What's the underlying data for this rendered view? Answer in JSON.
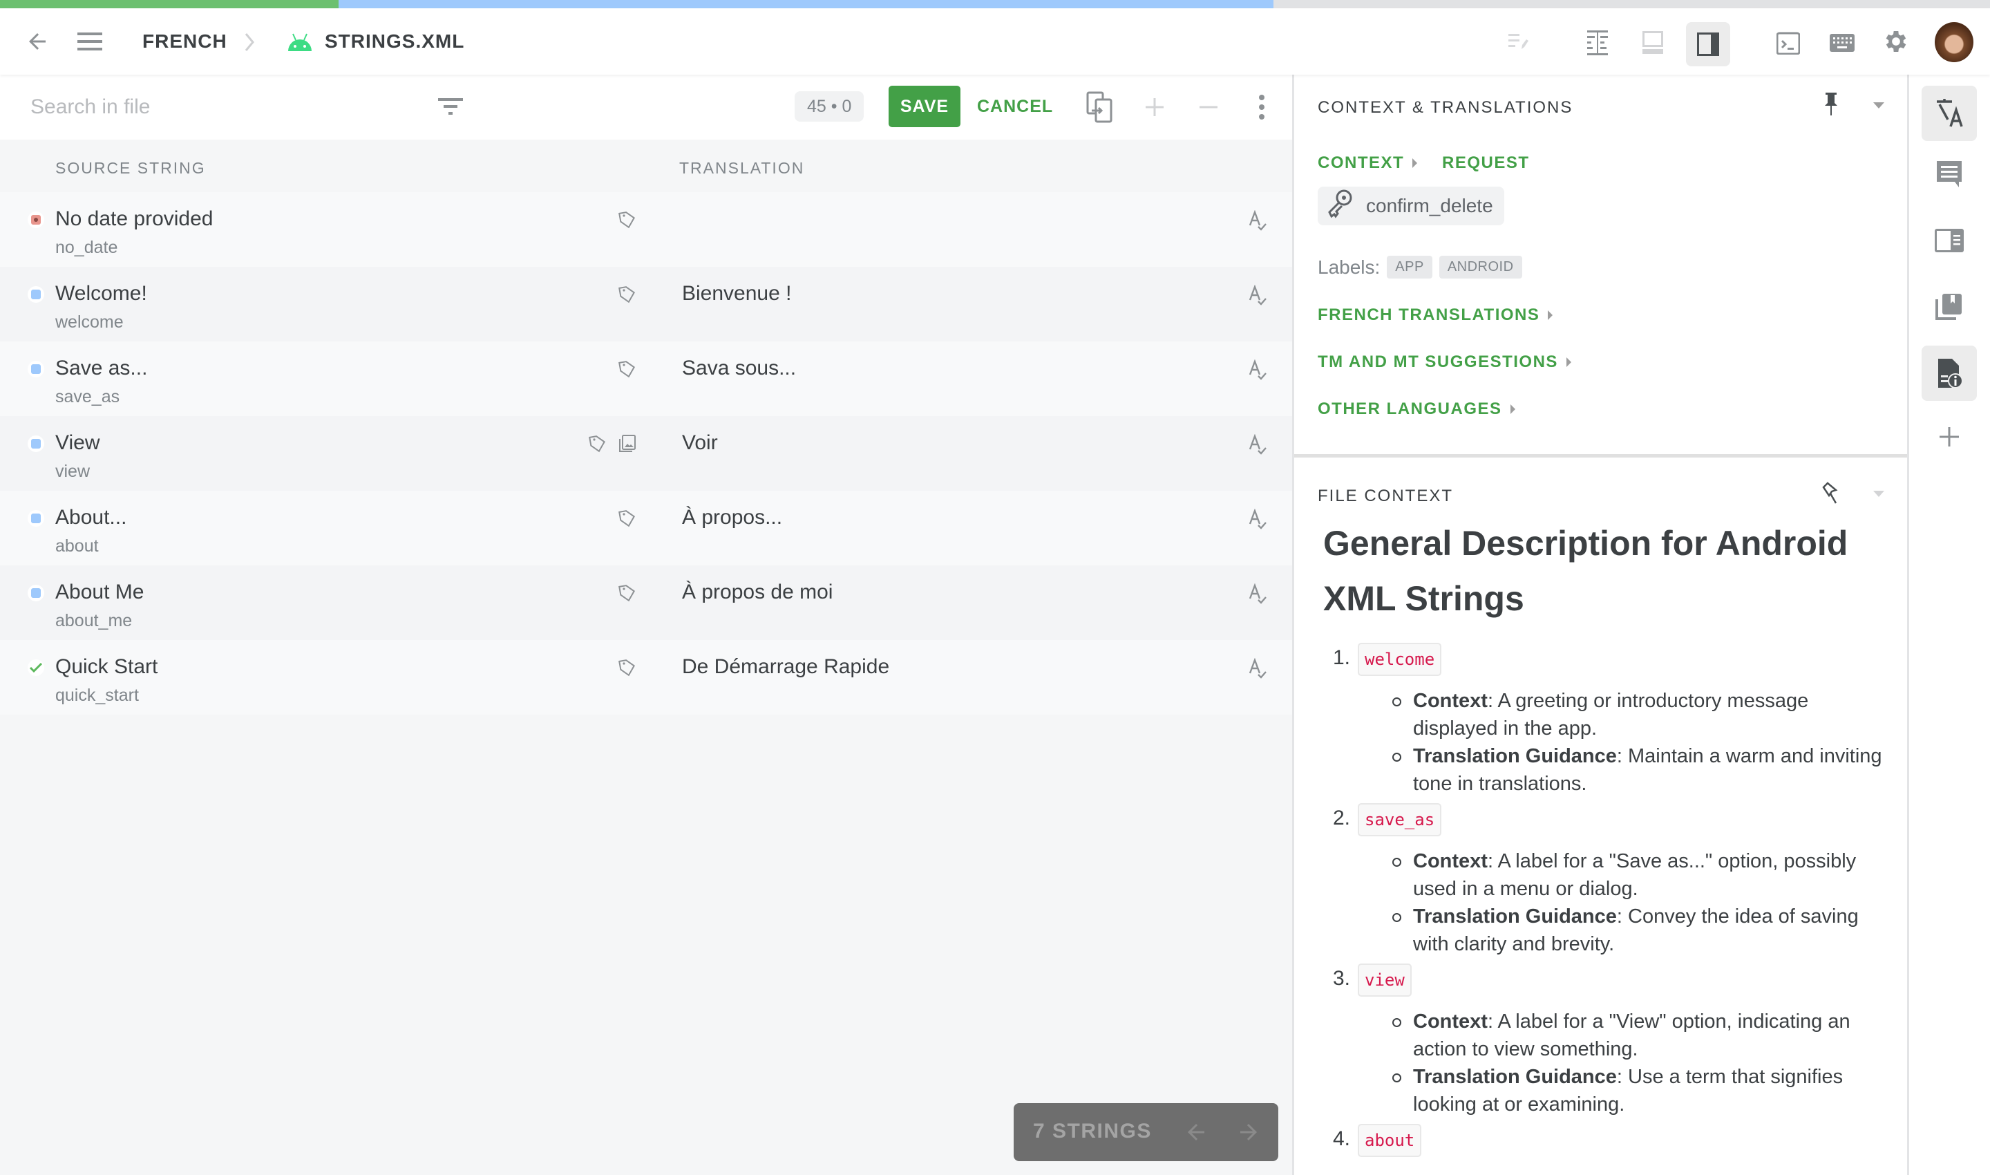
{
  "progress": {
    "approved_fraction": 0.17,
    "translated_fraction": 0.47,
    "colors": {
      "approved": "#6cc070",
      "translated": "#9ec9fc",
      "remaining": "#e1e2e4"
    }
  },
  "header": {
    "breadcrumb": [
      "FRENCH",
      "STRINGS.XML"
    ],
    "icons": [
      "back-arrow-icon",
      "menu-icon",
      "chevron-right-icon",
      "android-icon",
      "edit-list-icon",
      "side-by-side-icon",
      "horizontal-layout-icon",
      "sidebar-layout-icon",
      "terminal-icon",
      "keyboard-icon",
      "settings-gear-icon",
      "user-avatar"
    ]
  },
  "toolbar": {
    "search_placeholder": "Search in file",
    "counter": "45 • 0",
    "save_label": "SAVE",
    "cancel_label": "CANCEL"
  },
  "table": {
    "columns": [
      "SOURCE STRING",
      "TRANSLATION"
    ],
    "rows": [
      {
        "source": "No date provided",
        "key": "no_date",
        "translation": "",
        "status": "untranslated",
        "has_screenshot": false
      },
      {
        "source": "Welcome!",
        "key": "welcome",
        "translation": "Bienvenue !",
        "status": "translated",
        "has_screenshot": false
      },
      {
        "source": "Save as...",
        "key": "save_as",
        "translation": "Sava sous...",
        "status": "translated",
        "has_screenshot": false
      },
      {
        "source": "View",
        "key": "view",
        "translation": "Voir",
        "status": "translated",
        "has_screenshot": true
      },
      {
        "source": "About...",
        "key": "about",
        "translation": "À propos...",
        "status": "translated",
        "has_screenshot": false
      },
      {
        "source": "About Me",
        "key": "about_me",
        "translation": "À propos de moi",
        "status": "translated",
        "has_screenshot": false
      },
      {
        "source": "Quick Start",
        "key": "quick_start",
        "translation": "De Démarrage Rapide",
        "status": "approved",
        "has_screenshot": false
      }
    ]
  },
  "status_colors": {
    "untranslated": "#e8958d",
    "translated": "#9ec9fc",
    "approved": "#5cb85c"
  },
  "pager": {
    "label": "7 STRINGS"
  },
  "context_panel": {
    "title": "CONTEXT & TRANSLATIONS",
    "context_link": "CONTEXT",
    "request_link": "REQUEST",
    "key": "confirm_delete",
    "labels_prefix": "Labels:",
    "labels": [
      "APP",
      "ANDROID"
    ],
    "sections": [
      "FRENCH TRANSLATIONS",
      "TM AND MT SUGGESTIONS",
      "OTHER LANGUAGES"
    ]
  },
  "file_context": {
    "title": "FILE CONTEXT",
    "heading": "General Description for Android XML Strings",
    "items": [
      {
        "num": "1.",
        "key": "welcome",
        "context_label": "Context",
        "context": ": A greeting or introductory message displayed in the app.",
        "guidance_label": "Translation Guidance",
        "guidance": ": Maintain a warm and inviting tone in translations."
      },
      {
        "num": "2.",
        "key": "save_as",
        "context_label": "Context",
        "context": ": A label for a \"Save as...\" option, possibly used in a menu or dialog.",
        "guidance_label": "Translation Guidance",
        "guidance": ": Convey the idea of saving with clarity and brevity."
      },
      {
        "num": "3.",
        "key": "view",
        "context_label": "Context",
        "context": ": A label for a \"View\" option, indicating an action to view something.",
        "guidance_label": "Translation Guidance",
        "guidance": ": Use a term that signifies looking at or examining."
      },
      {
        "num": "4.",
        "key": "about"
      }
    ]
  },
  "rail": {
    "items": [
      "translate-icon",
      "comments-icon",
      "glossary-icon",
      "translation-memory-icon",
      "file-info-icon",
      "add-icon"
    ],
    "active": [
      "translate-icon",
      "file-info-icon"
    ]
  },
  "accent": "#43a047"
}
